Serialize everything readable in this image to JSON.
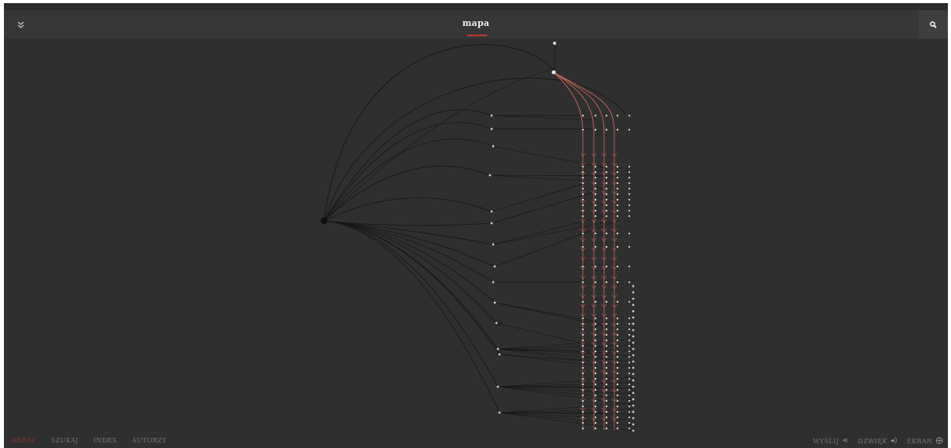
{
  "header": {
    "title": "mapa",
    "menu_icon": "double-chevron-down-icon",
    "search_icon": "search-icon"
  },
  "colors": {
    "background": "#2f2f2f",
    "header": "#363636",
    "accent": "#c0392b",
    "edge": "#151515",
    "edge_highlight": "#d0675c"
  },
  "nav": {
    "items": [
      "OBRAZ",
      "SZUKAJ",
      "INDEX",
      "AUTORZY"
    ],
    "active": "OBRAZ"
  },
  "tools": {
    "share_label": "WYŚLIJ",
    "share_icon": "share-icon",
    "sound_label": "DŹWIĘK",
    "sound_icon": "speaker-icon",
    "screen_label": "EKRAN",
    "screen_icon": "fullscreen-icon"
  }
}
